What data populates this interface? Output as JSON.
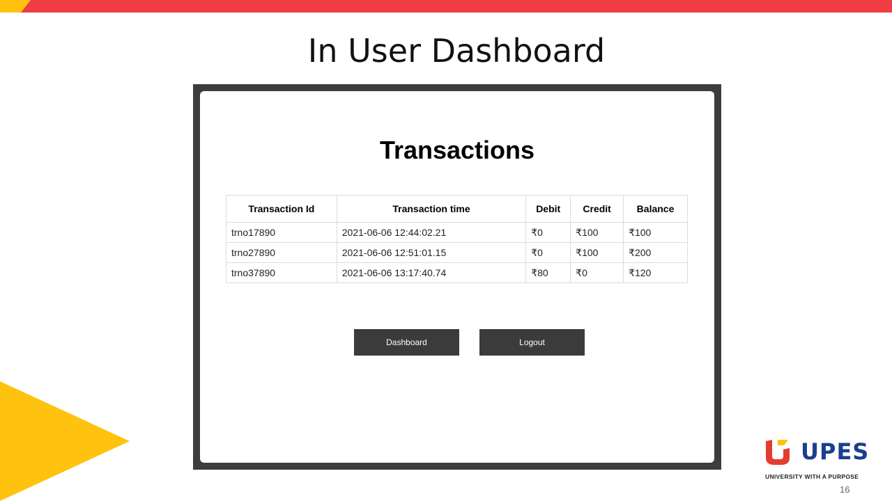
{
  "slide": {
    "title": "In User Dashboard",
    "page_number": "16"
  },
  "screen": {
    "heading": "Transactions",
    "table": {
      "headers": [
        "Transaction Id",
        "Transaction time",
        "Debit",
        "Credit",
        "Balance"
      ],
      "rows": [
        [
          "trno17890",
          "2021-06-06 12:44:02.21",
          "₹0",
          "₹100",
          "₹100"
        ],
        [
          "trno27890",
          "2021-06-06 12:51:01.15",
          "₹0",
          "₹100",
          "₹200"
        ],
        [
          "trno37890",
          "2021-06-06 13:17:40.74",
          "₹80",
          "₹0",
          "₹120"
        ]
      ]
    },
    "buttons": {
      "dashboard": "Dashboard",
      "logout": "Logout"
    }
  },
  "logo": {
    "word": "UPES",
    "tagline": "UNIVERSITY WITH A PURPOSE",
    "icon": "upes-logo-icon"
  },
  "colors": {
    "top_bar": "#ee3e44",
    "accent_yellow": "#ffc20e",
    "frame": "#3d3d3d",
    "button": "#3b3b3b",
    "logo_blue": "#1b3f8f",
    "logo_red": "#e43d30"
  }
}
